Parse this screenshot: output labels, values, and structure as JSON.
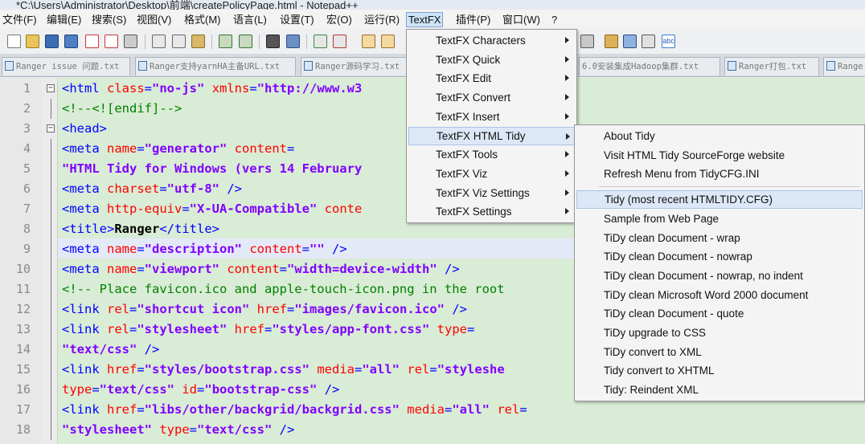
{
  "window": {
    "title": "*C:\\Users\\Administrator\\Desktop\\前端\\createPolicyPage.html - Notepad++"
  },
  "menubar": {
    "items": [
      {
        "label": "文件(F)"
      },
      {
        "label": "编辑(E)"
      },
      {
        "label": "搜索(S)"
      },
      {
        "label": "视图(V)"
      },
      {
        "label": "格式(M)"
      },
      {
        "label": "语言(L)"
      },
      {
        "label": "设置(T)"
      },
      {
        "label": "宏(O)"
      },
      {
        "label": "运行(R)"
      },
      {
        "label": "TextFX"
      },
      {
        "label": "插件(P)"
      },
      {
        "label": "窗口(W)"
      },
      {
        "label": "?"
      }
    ]
  },
  "toolbar": {
    "icons": [
      "new-file-icon",
      "open-file-icon",
      "save-icon",
      "save-all-icon",
      "close-icon",
      "close-all-icon",
      "print-icon",
      "cut-icon",
      "copy-icon",
      "paste-icon",
      "undo-icon",
      "redo-icon",
      "find-icon",
      "replace-icon",
      "zoom-in-icon",
      "zoom-out-icon",
      "sync-vertical-icon",
      "sync-horizontal-icon",
      "macro-record-icon",
      "macro-stop-icon",
      "macro-play-icon",
      "spellcheck-icon"
    ]
  },
  "tabs": [
    {
      "label": "Ranger issue 问题.txt"
    },
    {
      "label": "Ranger支持yarnHA主备URL.txt"
    },
    {
      "label": "Ranger源码学习.txt"
    },
    {
      "label": "6.0安装集成Hadoop集群.txt"
    },
    {
      "label": "Ranger打包.txt"
    },
    {
      "label": "Range"
    }
  ],
  "editor": {
    "lines": [
      {
        "n": "1",
        "fold": "box",
        "html": [
          [
            "k-tag",
            "<html "
          ],
          [
            "k-attr",
            "class"
          ],
          [
            "k-tag",
            "="
          ],
          [
            "k-str",
            "\"no-js\""
          ],
          [
            "k-tag",
            " "
          ],
          [
            "k-attr",
            "xmlns"
          ],
          [
            "k-tag",
            "="
          ],
          [
            "k-str",
            "\"http://www.w3"
          ]
        ]
      },
      {
        "n": "2",
        "fold": "line",
        "html": [
          [
            "k-com",
            "<!--<![endif]-->"
          ]
        ]
      },
      {
        "n": "3",
        "fold": "box",
        "html": [
          [
            "k-tag",
            "<head>"
          ]
        ]
      },
      {
        "n": "4",
        "fold": "line",
        "html": [
          [
            "k-tag",
            "<meta "
          ],
          [
            "k-attr",
            "name"
          ],
          [
            "k-tag",
            "="
          ],
          [
            "k-str",
            "\"generator\""
          ],
          [
            "k-tag",
            " "
          ],
          [
            "k-attr",
            "content"
          ],
          [
            "k-tag",
            "="
          ]
        ]
      },
      {
        "n": "5",
        "fold": "line",
        "html": [
          [
            "k-str",
            "\"HTML Tidy for Windows (vers 14 February"
          ]
        ]
      },
      {
        "n": "6",
        "fold": "line",
        "html": [
          [
            "k-tag",
            "<meta "
          ],
          [
            "k-attr",
            "charset"
          ],
          [
            "k-tag",
            "="
          ],
          [
            "k-str",
            "\"utf-8\""
          ],
          [
            "k-tag",
            " />"
          ]
        ]
      },
      {
        "n": "7",
        "fold": "line",
        "html": [
          [
            "k-tag",
            "<meta "
          ],
          [
            "k-attr",
            "http-equiv"
          ],
          [
            "k-tag",
            "="
          ],
          [
            "k-str",
            "\"X-UA-Compatible\""
          ],
          [
            "k-tag",
            " "
          ],
          [
            "k-attr",
            "conte"
          ]
        ]
      },
      {
        "n": "8",
        "fold": "line",
        "html": [
          [
            "k-tag",
            "<title>"
          ],
          [
            "k-txt",
            "Ranger"
          ],
          [
            "k-tag",
            "</title>"
          ]
        ]
      },
      {
        "n": "9",
        "fold": "line",
        "html": [
          [
            "k-tag",
            "<meta "
          ],
          [
            "k-attr",
            "name"
          ],
          [
            "k-tag",
            "="
          ],
          [
            "k-str",
            "\"description\""
          ],
          [
            "k-tag",
            " "
          ],
          [
            "k-attr",
            "content"
          ],
          [
            "k-tag",
            "="
          ],
          [
            "k-str",
            "\"\""
          ],
          [
            "k-tag",
            " />"
          ]
        ]
      },
      {
        "n": "10",
        "fold": "line",
        "html": [
          [
            "k-tag",
            "<meta "
          ],
          [
            "k-attr",
            "name"
          ],
          [
            "k-tag",
            "="
          ],
          [
            "k-str",
            "\"viewport\""
          ],
          [
            "k-tag",
            " "
          ],
          [
            "k-attr",
            "content"
          ],
          [
            "k-tag",
            "="
          ],
          [
            "k-str",
            "\"width=device-width\""
          ],
          [
            "k-tag",
            " />"
          ]
        ]
      },
      {
        "n": "11",
        "fold": "line",
        "html": [
          [
            "k-com",
            "<!-- Place favicon.ico and apple-touch-icon.png in the root"
          ]
        ]
      },
      {
        "n": "12",
        "fold": "line",
        "html": [
          [
            "k-tag",
            "<link "
          ],
          [
            "k-attr",
            "rel"
          ],
          [
            "k-tag",
            "="
          ],
          [
            "k-str",
            "\"shortcut icon\""
          ],
          [
            "k-tag",
            " "
          ],
          [
            "k-attr",
            "href"
          ],
          [
            "k-tag",
            "="
          ],
          [
            "k-str",
            "\"images/favicon.ico\""
          ],
          [
            "k-tag",
            " />"
          ]
        ]
      },
      {
        "n": "13",
        "fold": "line",
        "html": [
          [
            "k-tag",
            "<link "
          ],
          [
            "k-attr",
            "rel"
          ],
          [
            "k-tag",
            "="
          ],
          [
            "k-str",
            "\"stylesheet\""
          ],
          [
            "k-tag",
            " "
          ],
          [
            "k-attr",
            "href"
          ],
          [
            "k-tag",
            "="
          ],
          [
            "k-str",
            "\"styles/app-font.css\""
          ],
          [
            "k-tag",
            " "
          ],
          [
            "k-attr",
            "type"
          ],
          [
            "k-tag",
            "="
          ]
        ]
      },
      {
        "n": "14",
        "fold": "line",
        "html": [
          [
            "k-str",
            "\"text/css\""
          ],
          [
            "k-tag",
            " />"
          ]
        ]
      },
      {
        "n": "15",
        "fold": "line",
        "html": [
          [
            "k-tag",
            "<link "
          ],
          [
            "k-attr",
            "href"
          ],
          [
            "k-tag",
            "="
          ],
          [
            "k-str",
            "\"styles/bootstrap.css\""
          ],
          [
            "k-tag",
            " "
          ],
          [
            "k-attr",
            "media"
          ],
          [
            "k-tag",
            "="
          ],
          [
            "k-str",
            "\"all\""
          ],
          [
            "k-tag",
            " "
          ],
          [
            "k-attr",
            "rel"
          ],
          [
            "k-tag",
            "="
          ],
          [
            "k-str",
            "\"styleshe"
          ]
        ]
      },
      {
        "n": "16",
        "fold": "line",
        "html": [
          [
            "k-attr",
            "type"
          ],
          [
            "k-tag",
            "="
          ],
          [
            "k-str",
            "\"text/css\""
          ],
          [
            "k-tag",
            " "
          ],
          [
            "k-attr",
            "id"
          ],
          [
            "k-tag",
            "="
          ],
          [
            "k-str",
            "\"bootstrap-css\""
          ],
          [
            "k-tag",
            " />"
          ]
        ]
      },
      {
        "n": "17",
        "fold": "line",
        "html": [
          [
            "k-tag",
            "<link "
          ],
          [
            "k-attr",
            "href"
          ],
          [
            "k-tag",
            "="
          ],
          [
            "k-str",
            "\"libs/other/backgrid/backgrid.css\""
          ],
          [
            "k-tag",
            " "
          ],
          [
            "k-attr",
            "media"
          ],
          [
            "k-tag",
            "="
          ],
          [
            "k-str",
            "\"all\""
          ],
          [
            "k-tag",
            " "
          ],
          [
            "k-attr",
            "rel"
          ],
          [
            "k-tag",
            "="
          ]
        ]
      },
      {
        "n": "18",
        "fold": "line",
        "html": [
          [
            "k-str",
            "\"stylesheet\""
          ],
          [
            "k-tag",
            " "
          ],
          [
            "k-attr",
            "type"
          ],
          [
            "k-tag",
            "="
          ],
          [
            "k-str",
            "\"text/css\""
          ],
          [
            "k-tag",
            " />"
          ]
        ]
      }
    ]
  },
  "textfx_menu": {
    "items": [
      {
        "label": "TextFX Characters"
      },
      {
        "label": "TextFX Quick"
      },
      {
        "label": "TextFX Edit"
      },
      {
        "label": "TextFX Convert"
      },
      {
        "label": "TextFX Insert"
      },
      {
        "label": "TextFX HTML Tidy"
      },
      {
        "label": "TextFX Tools"
      },
      {
        "label": "TextFX Viz"
      },
      {
        "label": "TextFX Viz Settings"
      },
      {
        "label": "TextFX Settings"
      }
    ],
    "highlighted_index": 5
  },
  "tidy_submenu": {
    "items": [
      {
        "label": "About Tidy"
      },
      {
        "label": "Visit HTML Tidy SourceForge website"
      },
      {
        "label": "Refresh Menu from TidyCFG.INI"
      },
      {
        "label": "Tidy (most recent HTMLTIDY.CFG)"
      },
      {
        "label": "Sample from Web Page"
      },
      {
        "label": "TiDy clean Document - wrap"
      },
      {
        "label": "TiDy clean Document - nowrap"
      },
      {
        "label": "TiDy clean Document - nowrap, no indent"
      },
      {
        "label": "TiDy clean Microsoft Word 2000 document"
      },
      {
        "label": "TiDy clean Document - quote"
      },
      {
        "label": "TiDy upgrade to CSS"
      },
      {
        "label": "TiDy convert to XML"
      },
      {
        "label": "Tidy convert to XHTML"
      },
      {
        "label": "Tidy: Reindent XML"
      }
    ],
    "highlighted_index": 3
  }
}
